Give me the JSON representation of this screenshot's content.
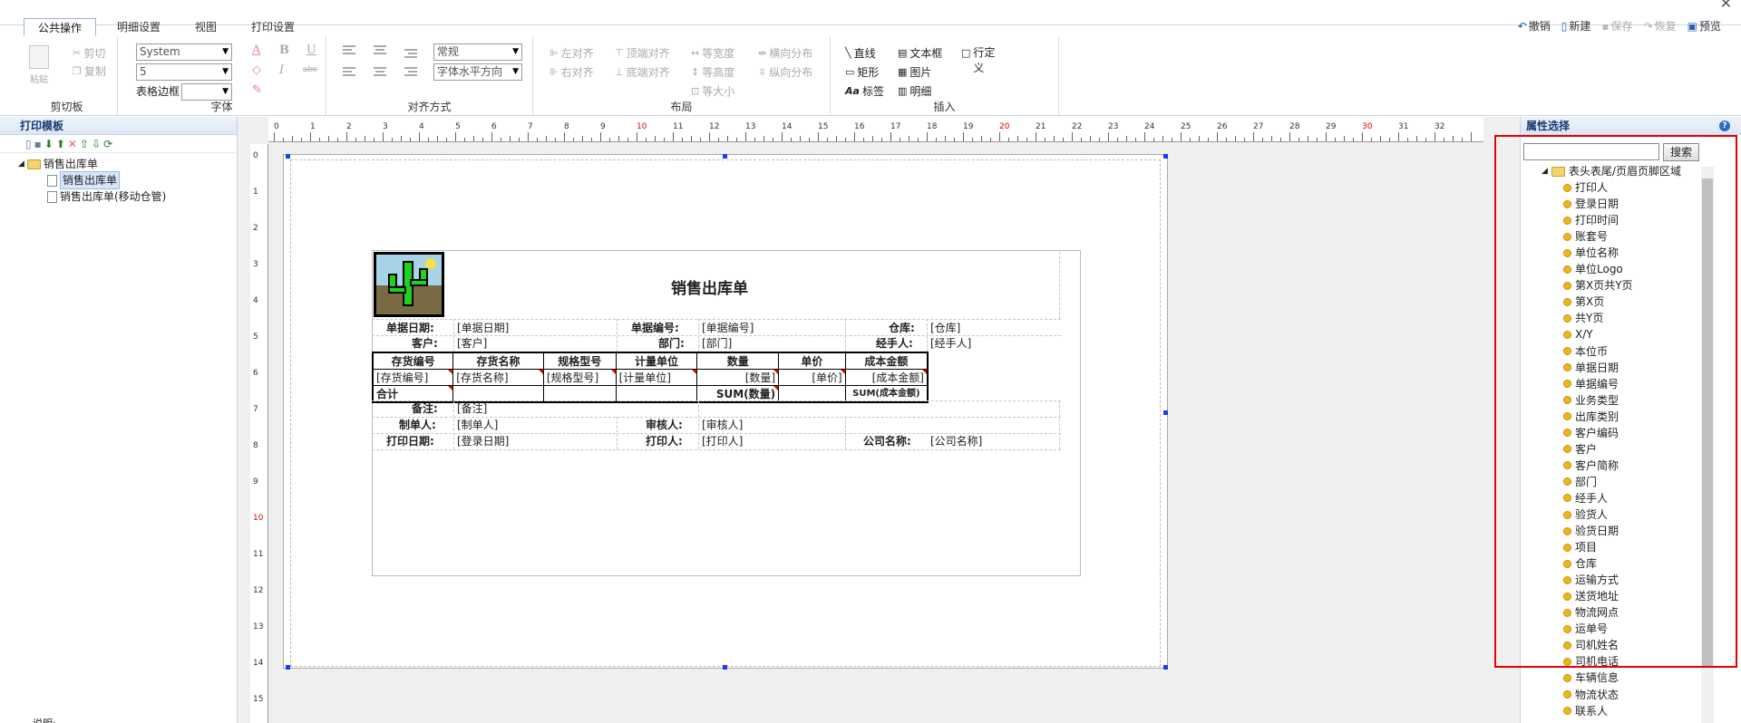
{
  "tabs": [
    {
      "label": "公共操作",
      "active": true
    },
    {
      "label": "明细设置"
    },
    {
      "label": "视图"
    },
    {
      "label": "打印设置"
    }
  ],
  "top_actions": [
    {
      "label": "撤销",
      "icon": "undo-icon",
      "enabled": true
    },
    {
      "label": "新建",
      "icon": "new-doc-icon",
      "enabled": true
    },
    {
      "label": "保存",
      "icon": "save-icon",
      "enabled": false
    },
    {
      "label": "恢复",
      "icon": "redo-icon",
      "enabled": false
    },
    {
      "label": "预览",
      "icon": "preview-icon",
      "enabled": true
    }
  ],
  "ribbon": {
    "clipboard": {
      "label": "剪切板",
      "paste": "粘贴",
      "cut": "剪切",
      "copy": "复制"
    },
    "font": {
      "label": "字体",
      "family": "System",
      "size": "5",
      "border_label": "表格边框",
      "border_value": ""
    },
    "align": {
      "label": "对齐方式",
      "style": "常规",
      "halign": "字体水平方向"
    },
    "layout": {
      "label": "布局",
      "items": [
        "左对齐",
        "顶端对齐",
        "等宽度",
        "横向分布",
        "右对齐",
        "底端对齐",
        "等高度",
        "纵向分布",
        "等大小"
      ]
    },
    "insert": {
      "label": "插入",
      "items": [
        "直线",
        "文本框",
        "行定义",
        "矩形",
        "图片",
        "标签",
        "明细"
      ]
    }
  },
  "left_panel": {
    "title": "打印模板",
    "tree": {
      "root": "销售出库单",
      "children": [
        "销售出库单",
        "销售出库单(移动仓管)"
      ]
    },
    "note": "说明:"
  },
  "ruler": {
    "h": [
      "0",
      "1",
      "2",
      "3",
      "4",
      "5",
      "6",
      "7",
      "8",
      "9",
      "10",
      "11",
      "12",
      "13",
      "14",
      "15",
      "16",
      "17",
      "18",
      "19",
      "20",
      "21",
      "22",
      "23",
      "24",
      "25",
      "26",
      "27",
      "28",
      "29",
      "30",
      "31",
      "32"
    ],
    "v": [
      "0",
      "1",
      "2",
      "3",
      "4",
      "5",
      "6",
      "7",
      "8",
      "9",
      "10",
      "11",
      "12",
      "13",
      "14",
      "15"
    ]
  },
  "design": {
    "title": "销售出库单",
    "row1": {
      "l1": "单据日期:",
      "v1": "[单据日期]",
      "l2": "单据编号:",
      "v2": "[单据编号]",
      "l3": "仓库:",
      "v3": "[仓库]"
    },
    "row2": {
      "l1": "客户:",
      "v1": "[客户]",
      "l2": "部门:",
      "v2": "[部门]",
      "l3": "经手人:",
      "v3": "[经手人]"
    },
    "grid_header": [
      "存货编号",
      "存货名称",
      "规格型号",
      "计量单位",
      "数量",
      "单价",
      "成本金额"
    ],
    "grid_detail": [
      "[存货编号]",
      "[存货名称]",
      "[规格型号]",
      "[计量单位]",
      "[数量]",
      "[单价]",
      "[成本金额]"
    ],
    "grid_total": {
      "label": "合计",
      "qty": "SUM(数量)",
      "amt": "SUM(成本金额)"
    },
    "remark": {
      "l": "备注:",
      "v": "[备注]"
    },
    "maker": {
      "l1": "制单人:",
      "v1": "[制单人]",
      "l2": "审核人:",
      "v2": "[审核人]"
    },
    "print": {
      "l1": "打印日期:",
      "v1": "[登录日期]",
      "l2": "打印人:",
      "v2": "[打印人]",
      "l3": "公司名称:",
      "v3": "[公司名称]"
    }
  },
  "right_panel": {
    "title": "属性选择",
    "search_btn": "搜索",
    "search_placeholder": "",
    "root": "表头表尾/页眉页脚区域",
    "items": [
      "打印人",
      "登录日期",
      "打印时间",
      "账套号",
      "单位名称",
      "单位Logo",
      "第X页共Y页",
      "第X页",
      "共Y页",
      "X/Y",
      "本位币",
      "单据日期",
      "单据编号",
      "业务类型",
      "出库类别",
      "客户编码",
      "客户",
      "客户简称",
      "部门",
      "经手人",
      "验货人",
      "验货日期",
      "项目",
      "仓库",
      "运输方式",
      "送货地址",
      "物流网点",
      "运单号",
      "司机姓名",
      "司机电话",
      "车辆信息",
      "物流状态",
      "联系人"
    ]
  },
  "colors": {
    "highlight": "#e60000",
    "accent": "#2a5ca8"
  }
}
